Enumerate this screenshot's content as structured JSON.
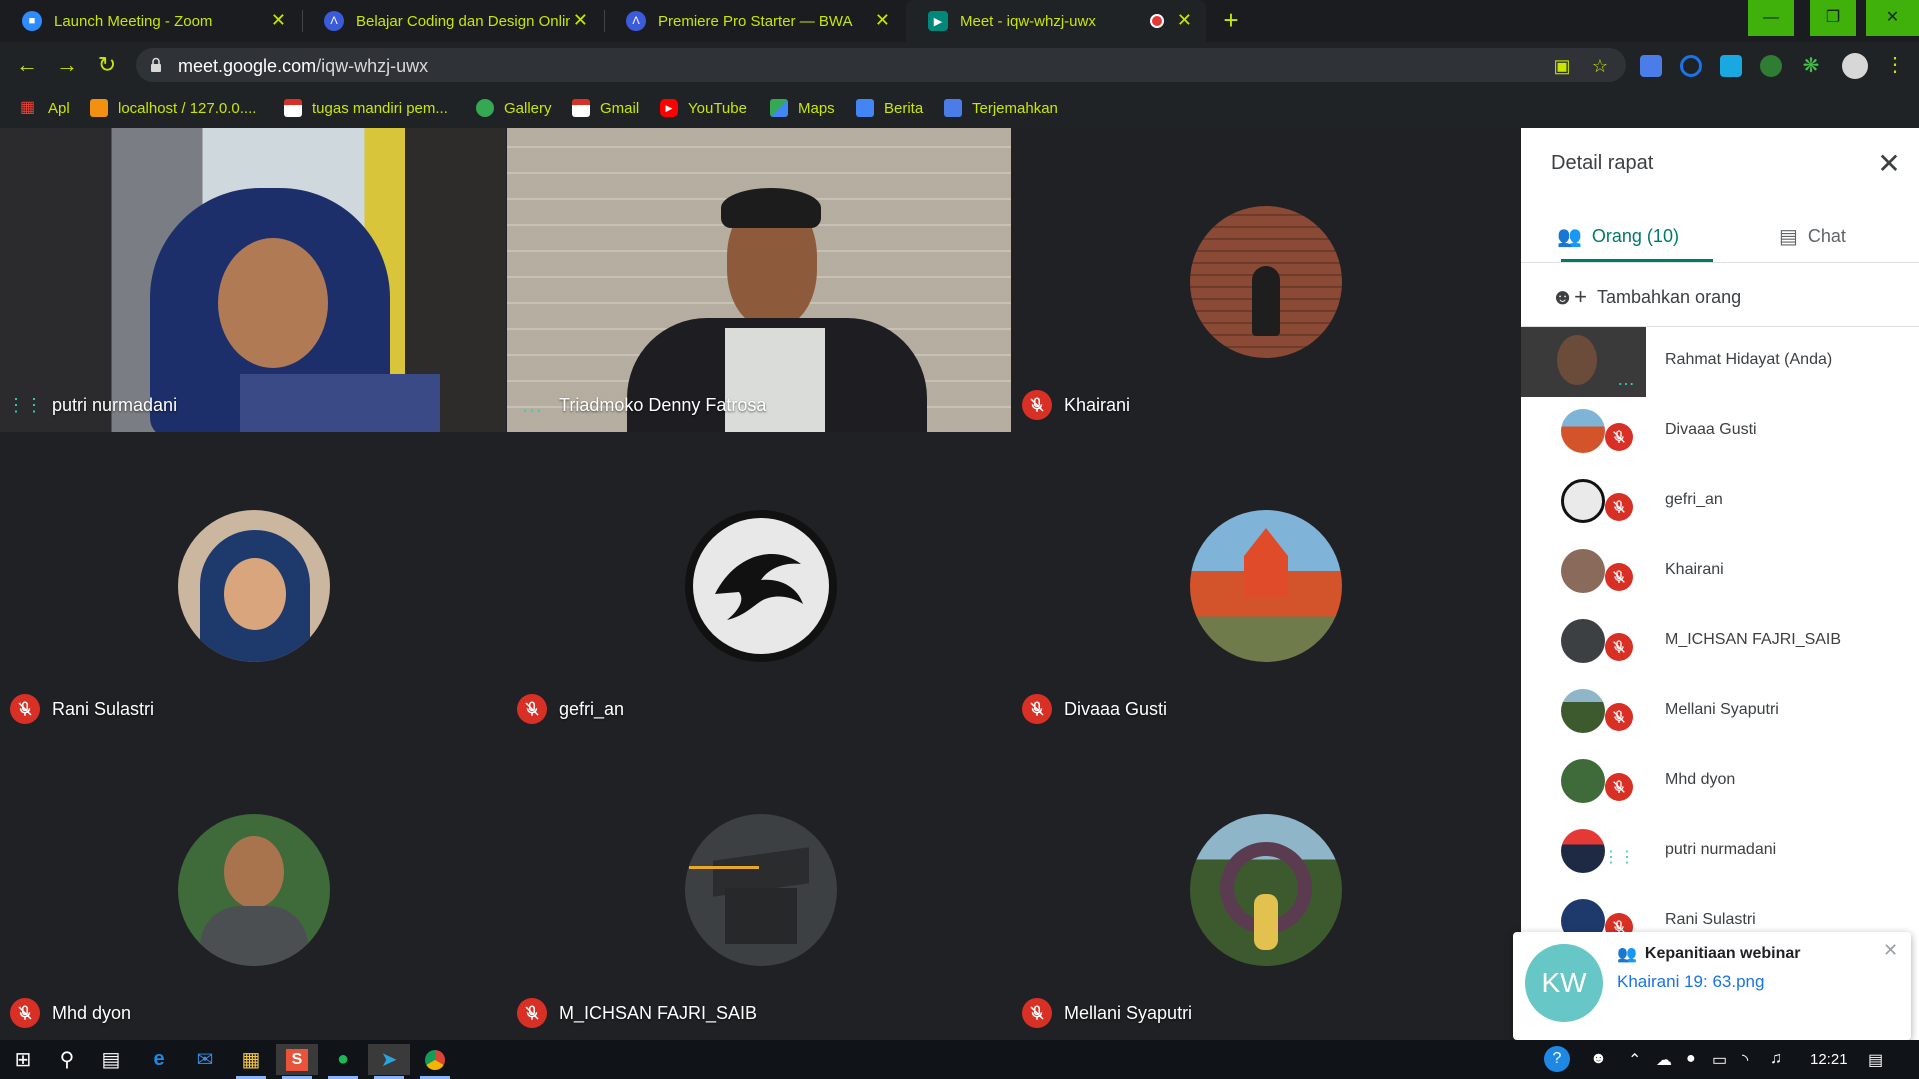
{
  "browser": {
    "tabs": [
      {
        "title": "Launch Meeting - Zoom",
        "icon": "zoom-icon",
        "icon_color": "#2d8cff"
      },
      {
        "title": "Belajar Coding dan Design Online",
        "icon": "bwa-icon",
        "icon_color": "#3b5bdb"
      },
      {
        "title": "Premiere Pro Starter — BWA",
        "icon": "bwa-icon",
        "icon_color": "#3b5bdb"
      },
      {
        "title": "Meet - iqw-whzj-uwx",
        "icon": "meet-icon",
        "icon_color": "#00897b",
        "active": true
      }
    ],
    "url_host": "meet.google.com",
    "url_path": "/iqw-whzj-uwx",
    "accent_color": "#c8e600",
    "bookmarks": [
      {
        "label": "Apl",
        "icon": "apps-grid-icon"
      },
      {
        "label": "localhost / 127.0.0....",
        "icon": "phpmyadmin-icon"
      },
      {
        "label": "tugas mandiri pem...",
        "icon": "gmail-icon"
      },
      {
        "label": "Gallery",
        "icon": "gallery-icon"
      },
      {
        "label": "Gmail",
        "icon": "gmail-icon"
      },
      {
        "label": "YouTube",
        "icon": "youtube-icon"
      },
      {
        "label": "Maps",
        "icon": "maps-icon"
      },
      {
        "label": "Berita",
        "icon": "news-icon"
      },
      {
        "label": "Terjemahkan",
        "icon": "translate-icon"
      }
    ]
  },
  "meet": {
    "tiles": [
      {
        "name": "putri nurmadani",
        "status": "speaking",
        "kind": "video"
      },
      {
        "name": "Triadmoko Denny Fatrosa",
        "status": "more",
        "kind": "video"
      },
      {
        "name": "Khairani",
        "status": "muted",
        "kind": "avatar"
      },
      {
        "name": "Rani Sulastri",
        "status": "muted",
        "kind": "avatar"
      },
      {
        "name": "gefri_an",
        "status": "muted",
        "kind": "avatar"
      },
      {
        "name": "Divaaa Gusti",
        "status": "muted",
        "kind": "avatar"
      },
      {
        "name": "Mhd dyon",
        "status": "muted",
        "kind": "avatar"
      },
      {
        "name": "M_ICHSAN FAJRI_SAIB",
        "status": "muted",
        "kind": "avatar"
      },
      {
        "name": "Mellani Syaputri",
        "status": "muted",
        "kind": "avatar"
      }
    ],
    "panel": {
      "title": "Detail rapat",
      "tab_people": "Orang (10)",
      "tab_chat": "Chat",
      "add_people": "Tambahkan orang",
      "people": [
        {
          "name": "Rahmat Hidayat (Anda)",
          "status": "self"
        },
        {
          "name": "Divaaa Gusti",
          "status": "muted"
        },
        {
          "name": "gefri_an",
          "status": "muted"
        },
        {
          "name": "Khairani",
          "status": "muted"
        },
        {
          "name": "M_ICHSAN FAJRI_SAIB",
          "status": "muted"
        },
        {
          "name": "Mellani Syaputri",
          "status": "muted"
        },
        {
          "name": "Mhd dyon",
          "status": "muted"
        },
        {
          "name": "putri nurmadani",
          "status": "speaking"
        },
        {
          "name": "Rani Sulastri",
          "status": "muted"
        }
      ]
    },
    "notification": {
      "initials": "KW",
      "title": "Kepanitiaan webinar",
      "body": "Khairani 19: 63.png"
    }
  },
  "taskbar": {
    "clock": "12:21"
  }
}
